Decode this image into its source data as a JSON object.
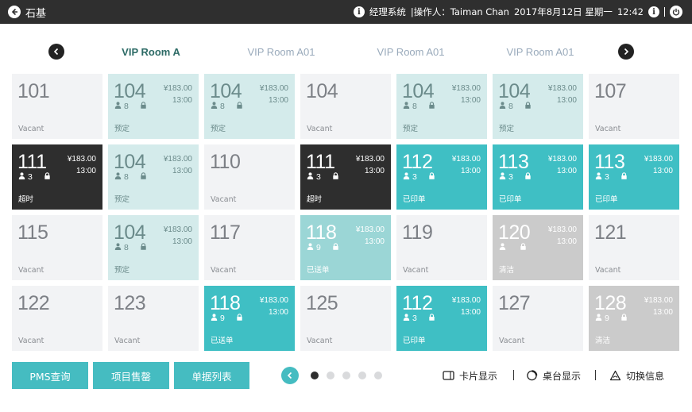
{
  "topbar": {
    "store_name": "石基",
    "system": "经理系统",
    "operator": "|操作人：Taiman Chan",
    "date": "2017年8月12日 星期一",
    "time": "12:42",
    "info_glyph": "i"
  },
  "tabs": [
    "VIP Room A",
    "VIP Room A01",
    "VIP Room A01",
    "VIP Room A01"
  ],
  "rooms": [
    [
      {
        "num": "101",
        "status": "Vacant",
        "state": "vacant"
      },
      {
        "num": "104",
        "price": "¥183.00",
        "time": "13:00",
        "guests": "8",
        "status": "预定",
        "state": "booked"
      },
      {
        "num": "104",
        "price": "¥183.00",
        "time": "13:00",
        "guests": "8",
        "status": "预定",
        "state": "booked"
      },
      {
        "num": "104",
        "status": "Vacant",
        "state": "vacant"
      },
      {
        "num": "104",
        "price": "¥183.00",
        "time": "13:00",
        "guests": "8",
        "status": "预定",
        "state": "booked"
      },
      {
        "num": "104",
        "price": "¥183.00",
        "time": "13:00",
        "guests": "8",
        "status": "预定",
        "state": "booked"
      },
      {
        "num": "107",
        "status": "Vacant",
        "state": "vacant"
      }
    ],
    [
      {
        "num": "111",
        "price": "¥183.00",
        "time": "13:00",
        "guests": "3",
        "status": "超时",
        "state": "overtime"
      },
      {
        "num": "104",
        "price": "¥183.00",
        "time": "13:00",
        "guests": "8",
        "status": "预定",
        "state": "booked"
      },
      {
        "num": "110",
        "status": "Vacant",
        "state": "vacant"
      },
      {
        "num": "111",
        "price": "¥183.00",
        "time": "13:00",
        "guests": "3",
        "status": "超时",
        "state": "overtime"
      },
      {
        "num": "112",
        "price": "¥183.00",
        "time": "13:00",
        "guests": "3",
        "status": "已印单",
        "state": "printed"
      },
      {
        "num": "113",
        "price": "¥183.00",
        "time": "13:00",
        "guests": "3",
        "status": "已印单",
        "state": "printed"
      },
      {
        "num": "113",
        "price": "¥183.00",
        "time": "13:00",
        "guests": "3",
        "status": "已印单",
        "state": "printed"
      }
    ],
    [
      {
        "num": "115",
        "status": "Vacant",
        "state": "vacant"
      },
      {
        "num": "104",
        "price": "¥183.00",
        "time": "13:00",
        "guests": "8",
        "status": "预定",
        "state": "booked"
      },
      {
        "num": "117",
        "status": "Vacant",
        "state": "vacant"
      },
      {
        "num": "118",
        "price": "¥183.00",
        "time": "13:00",
        "guests": "9",
        "status": "已送单",
        "state": "sent"
      },
      {
        "num": "119",
        "status": "Vacant",
        "state": "vacant"
      },
      {
        "num": "120",
        "price": "¥183.00",
        "time": "13:00",
        "guests": "",
        "status": "清洁",
        "state": "cleaning"
      },
      {
        "num": "121",
        "status": "Vacant",
        "state": "vacant"
      }
    ],
    [
      {
        "num": "122",
        "status": "Vacant",
        "state": "vacant"
      },
      {
        "num": "123",
        "status": "Vacant",
        "state": "vacant"
      },
      {
        "num": "118",
        "price": "¥183.00",
        "time": "13:00",
        "guests": "9",
        "status": "已送单",
        "state": "printed"
      },
      {
        "num": "125",
        "status": "Vacant",
        "state": "vacant"
      },
      {
        "num": "112",
        "price": "¥183.00",
        "time": "13:00",
        "guests": "3",
        "status": "已印单",
        "state": "printed"
      },
      {
        "num": "127",
        "status": "Vacant",
        "state": "vacant"
      },
      {
        "num": "128",
        "price": "¥183.00",
        "time": "13:00",
        "guests": "9",
        "status": "清洁",
        "state": "cleaning"
      }
    ]
  ],
  "bottom": {
    "buttons": [
      "PMS查询",
      "项目售罄",
      "单据列表"
    ],
    "pages": 5,
    "active_page": 0,
    "view_card": "卡片显示",
    "view_table": "桌台显示",
    "switch_info": "切换信息"
  },
  "colors": {
    "accent": "#45bcc1",
    "booked": "#d4ebeb",
    "overtime": "#2e2e2e",
    "printed": "#3fbfc4",
    "sent": "#9bd6d6",
    "cleaning": "#cbcbcb",
    "vacant": "#f2f3f5"
  }
}
